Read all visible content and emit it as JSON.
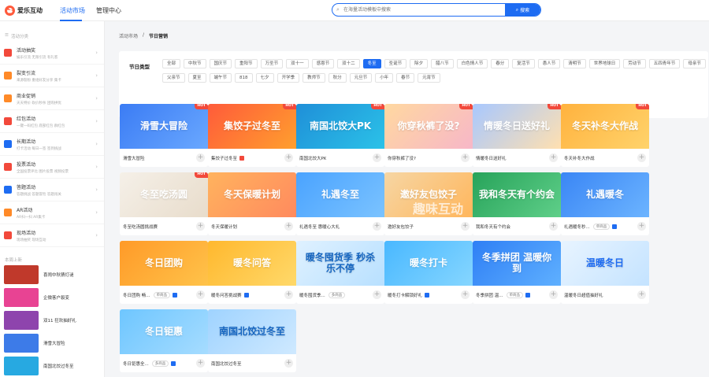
{
  "app": {
    "name": "爱乐互动"
  },
  "nav": [
    {
      "label": "活动市场"
    },
    {
      "label": "管理中心"
    }
  ],
  "search": {
    "placeholder": "在海量活动模板中搜索",
    "button": "搜索"
  },
  "sidebar": {
    "title": "活动分类",
    "items": [
      {
        "name": "活动抽奖",
        "desc": "娱乐引流   无限引流   有礼客",
        "color": "#f2493b"
      },
      {
        "name": "裂变引流",
        "desc": "来源裂粉   重组好友分享   集卡",
        "color": "#ff8a28"
      },
      {
        "name": "商业促销",
        "desc": "天天特价   砍价秒杀   团购拼优",
        "color": "#ff8a28"
      },
      {
        "name": "红包活动",
        "desc": "一键一码红包   底部红包   群红包",
        "color": "#f2493b"
      },
      {
        "name": "长期活动",
        "desc": "打卡活动   每日一签   签到挑战",
        "color": "#1e6cf2"
      },
      {
        "name": "投票活动",
        "desc": "全国投票评比   图片投票   视频投票",
        "color": "#f2493b"
      },
      {
        "name": "答题活动",
        "desc": "答题挑战   答题冒险   答题闯关",
        "color": "#1e6cf2"
      },
      {
        "name": "AR活动",
        "desc": "AR扫一扫   AR集卡",
        "color": "#ff8a28"
      },
      {
        "name": "现场活动",
        "desc": "现场抽奖   现场互动",
        "color": "#f2493b"
      }
    ],
    "recent_title": "本周上新",
    "recent": [
      {
        "name": "喜闹中秋猜灯谜",
        "color": "#c0392b"
      },
      {
        "name": "企微客户裂变",
        "color": "#e84393"
      },
      {
        "name": "双11 狂欢抽好礼",
        "color": "#8e44ad"
      },
      {
        "name": "滑雪大冒险",
        "color": "#3d7be8"
      },
      {
        "name": "南国北饺过冬至",
        "color": "#27a9e1"
      }
    ]
  },
  "breadcrumb": {
    "root": "活动市场",
    "sep": "/",
    "current": "节日营销"
  },
  "filter": {
    "label": "节日类型",
    "tags": [
      "全部",
      "中秋节",
      "国庆节",
      "重阳节",
      "万圣节",
      "双十一",
      "感恩节",
      "双十二",
      "冬至",
      "圣诞节",
      "除夕",
      "腊八节",
      "白色情人节",
      "春分",
      "复活节",
      "愚人节",
      "清明节",
      "世界地球日",
      "劳动节",
      "五四青年节",
      "母亲节",
      "父亲节",
      "夏至",
      "端午节",
      "818",
      "七夕",
      "开学季",
      "教师节",
      "秋分",
      "元旦节",
      "小年",
      "春节",
      "元宵节"
    ],
    "active": "冬至"
  },
  "cards": [
    {
      "title": "滑雪大冒险",
      "art": "滑雪大冒险",
      "hot": true,
      "bg": "linear-gradient(135deg,#3b7cf4,#6aa8ff)"
    },
    {
      "title": "集饺子过冬至",
      "art": "集饺子过冬至",
      "hot": true,
      "bg": "linear-gradient(135deg,#ff5b3a,#ff9f2e)",
      "mini": "#f2493b"
    },
    {
      "title": "南国北饺大PK",
      "art": "南国北饺大PK",
      "hot": true,
      "bg": "linear-gradient(135deg,#1f8fd8,#2bc2e8)"
    },
    {
      "title": "你穿秋裤了没?",
      "art": "你穿秋裤了没?",
      "hot": true,
      "bg": "linear-gradient(135deg,#ffd8a0,#f7b7c8)"
    },
    {
      "title": "情暖冬日送好礼",
      "art": "情暖冬日送好礼",
      "hot": true,
      "bg": "linear-gradient(135deg,#a8c8ff,#ffe0b0)"
    },
    {
      "title": "冬天补冬大作战",
      "art": "冬天补冬大作战",
      "hot": true,
      "bg": "linear-gradient(135deg,#ffb23e,#ffd36b)"
    },
    {
      "title": "冬至吃汤圆挑战赛",
      "art": "冬至吃汤圆",
      "hot": true,
      "bg": "linear-gradient(135deg,#f5f0e8,#e8dccb)"
    },
    {
      "title": "冬天保暖计划",
      "art": "冬天保暖计划",
      "hot": false,
      "bg": "linear-gradient(135deg,#ffb35e,#ff8a5e)"
    },
    {
      "title": "礼遇冬至 惠暖心大礼",
      "art": "礼遇冬至",
      "hot": false,
      "bg": "linear-gradient(135deg,#4aa3ff,#7bc3ff)"
    },
    {
      "title": "邀好友包饺子",
      "art": "邀好友包饺子",
      "hot": false,
      "bg": "linear-gradient(135deg,#f6d6a4,#ffb65c)"
    },
    {
      "title": "我和冬天有个约会",
      "art": "我和冬天有个约会",
      "hot": false,
      "bg": "linear-gradient(135deg,#27a35a,#5fcf89)"
    },
    {
      "title": "礼遇暖冬秒...",
      "art": "礼遇暖冬",
      "hot": false,
      "bg": "linear-gradient(135deg,#3a86f5,#6cb4ff)",
      "badge": "单商品",
      "mini": "#1e6cf2"
    },
    {
      "title": "冬日团购 畅...",
      "art": "冬日团购",
      "hot": false,
      "bg": "linear-gradient(135deg,#ff9a28,#ffc34a)",
      "badge": "单商品",
      "mini": "#1e6cf2"
    },
    {
      "title": "暖冬问答挑战赛",
      "art": "暖冬问答",
      "hot": false,
      "bg": "linear-gradient(135deg,#ffb82e,#ffd96a)",
      "mini": "#1e6cf2"
    },
    {
      "title": "暖冬囤货季...",
      "art": "暖冬囤货季 秒杀乐不停",
      "hot": false,
      "bg": "linear-gradient(135deg,#dff1ff,#b8e0ff)",
      "badge": "多商品",
      "textColor": "#1565c0"
    },
    {
      "title": "暖冬打卡解锁好礼",
      "art": "暖冬打卡",
      "hot": false,
      "bg": "linear-gradient(135deg,#49b8ff,#86d6ff)",
      "mini": "#1e6cf2"
    },
    {
      "title": "冬季拼团 温...",
      "art": "冬季拼团 温暖你到",
      "hot": false,
      "bg": "linear-gradient(135deg,#2f7ff5,#5fb0ff)",
      "badge": "单商品",
      "mini": "#1e6cf2"
    },
    {
      "title": "温暖冬日超值抽好礼",
      "art": "温暖冬日",
      "hot": false,
      "bg": "linear-gradient(135deg,#e8f4ff,#c4e3ff)",
      "textColor": "#1e6cf2"
    },
    {
      "title": "冬日钜惠全...",
      "art": "冬日钜惠",
      "hot": false,
      "bg": "linear-gradient(135deg,#6ec6ff,#a6dcff)",
      "badge": "多商品",
      "mini": "#1e6cf2"
    },
    {
      "title": "南国北饺过冬至",
      "art": "南国北饺过冬至",
      "hot": false,
      "bg": "linear-gradient(135deg,#9fd3ff,#cfe9ff)",
      "textColor": "#1565c0"
    }
  ],
  "hot_label": "HOT",
  "watermark": "趣味互动"
}
